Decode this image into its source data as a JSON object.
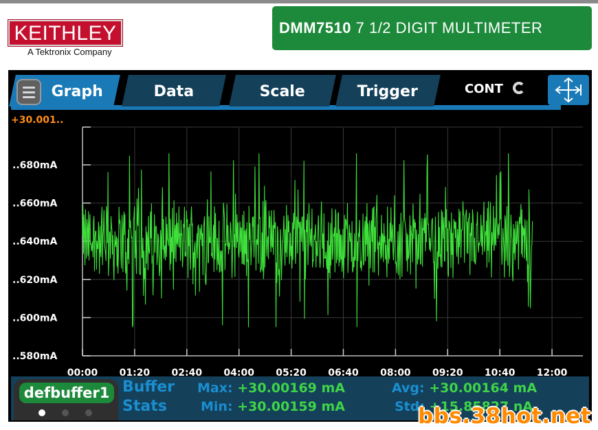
{
  "brand": {
    "logo_text": "KEITHLEY",
    "tagline": "A Tektronix Company"
  },
  "model": {
    "name": "DMM7510",
    "description": "7 1/2 DIGIT MULTIMETER"
  },
  "tabs": [
    {
      "label": "Graph",
      "active": true
    },
    {
      "label": "Data",
      "active": false
    },
    {
      "label": "Scale",
      "active": false
    },
    {
      "label": "Trigger",
      "active": false
    }
  ],
  "trigger_mode": {
    "label": "CONT",
    "icon": "refresh-icon"
  },
  "colors": {
    "trace": "#3ee03a",
    "accent": "#1a7ab8",
    "tab": "#14405a",
    "label": "#ffffff",
    "top_label": "#ff8c1a"
  },
  "chart_data": {
    "type": "line",
    "xlabel": "",
    "ylabel": "",
    "top_label": "+30.001..",
    "y_tick_labels": [
      "..680mA",
      "..660mA",
      "..640mA",
      "..620mA",
      "..600mA",
      "..580mA"
    ],
    "y_ticks_uA_offset": [
      680,
      660,
      640,
      620,
      600,
      580
    ],
    "x_tick_labels": [
      "00:00",
      "01:20",
      "02:40",
      "04:00",
      "05:20",
      "06:40",
      "08:00",
      "09:20",
      "10:40",
      "12:00"
    ],
    "x_ticks_s": [
      0,
      80,
      160,
      240,
      320,
      400,
      480,
      560,
      640,
      720
    ],
    "xlim": [
      0,
      720
    ],
    "ylim": [
      580,
      700
    ],
    "grid": true,
    "series": [
      {
        "x_end_s": 690,
        "min": 595,
        "max": 686,
        "mean": 640
      }
    ]
  },
  "buffer": {
    "name": "defbuffer1",
    "stats_title_1": "Buffer",
    "stats_title_2": "Stats",
    "max_label": "Max:",
    "max_value": "+30.00169 mA",
    "min_label": "Min:",
    "min_value": "+30.00159 mA",
    "avg_label": "Avg:",
    "avg_value": "+30.00164 mA",
    "std_label": "Std:",
    "std_value": "+15.85827 nA",
    "page_dots": 3,
    "active_dot": 0
  },
  "watermark": "bbs.38hot.net"
}
